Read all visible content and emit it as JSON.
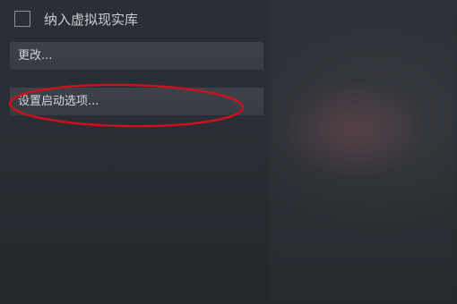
{
  "settings": {
    "include_vr_label": "纳入虚拟现实库",
    "include_vr_checked": false,
    "change_button_label": "更改...",
    "launch_options_button_label": "设置启动选项..."
  },
  "colors": {
    "annotation_circle": "#c8121c",
    "button_bg": "#3b3e45",
    "panel_bg": "#2b2e34"
  }
}
